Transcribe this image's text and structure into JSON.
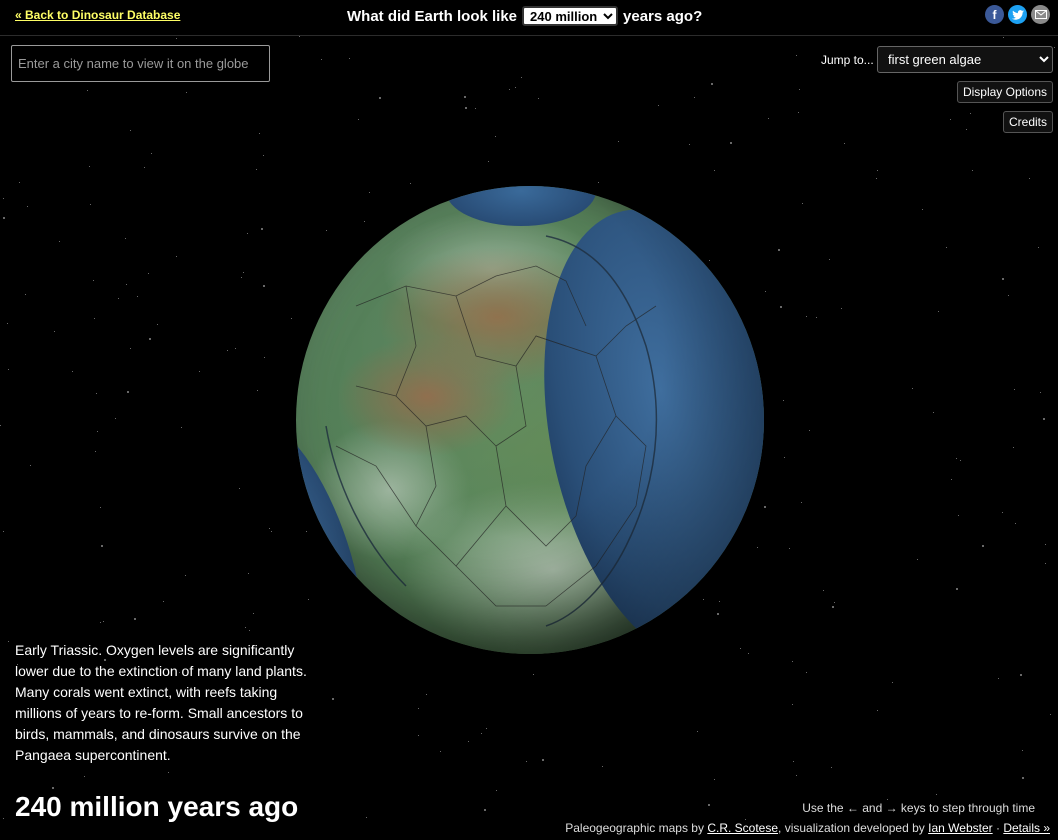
{
  "header": {
    "back_link": "« Back to Dinosaur Database",
    "title_prefix": "What did Earth look like",
    "title_suffix": "years ago?",
    "era_select_value": "240 million"
  },
  "share": {
    "icons": [
      "facebook-icon",
      "twitter-icon",
      "email-icon"
    ]
  },
  "search": {
    "placeholder": "Enter a city name to view it on the globe"
  },
  "jump": {
    "label": "Jump to...",
    "selected": "first green algae"
  },
  "buttons": {
    "display_options": "Display Options",
    "credits": "Credits"
  },
  "description": "Early Triassic. Oxygen levels are significantly lower due to the extinction of many land plants. Many corals went extinct, with reefs taking millions of years to re-form. Small ancestors to birds, mammals, and dinosaurs survive on the Pangaea supercontinent.",
  "age_heading": "240 million years ago",
  "hint": "Use the ← and → keys to step through time",
  "footer": {
    "maps_prefix": "Paleogeographic maps by",
    "maps_author": "C.R. Scotese",
    "viz_prefix": ", visualization developed by",
    "viz_author": "Ian Webster",
    "separator": "·",
    "details": "Details »"
  }
}
